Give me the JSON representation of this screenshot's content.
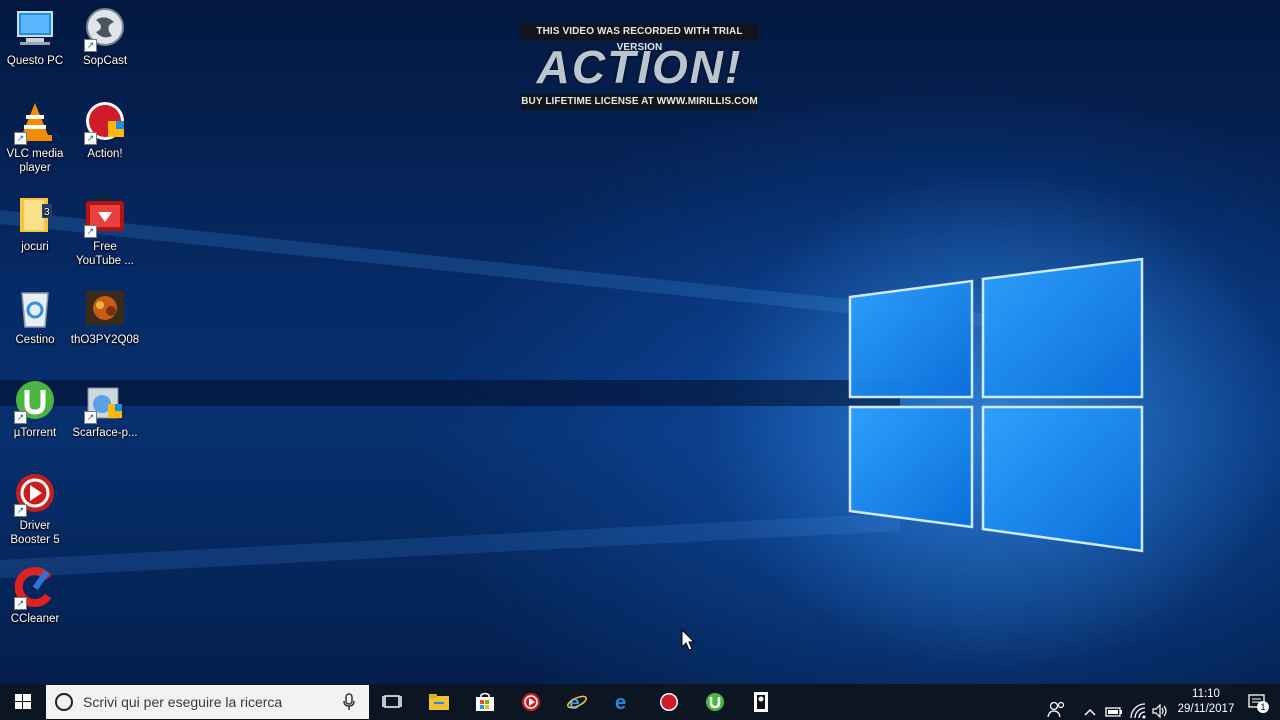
{
  "watermark": {
    "top": "THIS VIDEO WAS RECORDED WITH TRIAL VERSION",
    "logo": "ACTION!",
    "bottom": "BUY LIFETIME LICENSE AT WWW.MIRILLIS.COM"
  },
  "desktop": {
    "icons": [
      {
        "label": "Questo PC",
        "icon": "computer-icon"
      },
      {
        "label": "SopCast",
        "icon": "sopcast-icon"
      },
      {
        "label": "VLC media player",
        "icon": "vlc-cone-icon"
      },
      {
        "label": "Action!",
        "icon": "action-record-icon"
      },
      {
        "label": "jocuri",
        "icon": "folder-icon"
      },
      {
        "label": "Free YouTube ...",
        "icon": "tv-download-icon"
      },
      {
        "label": "Cestino",
        "icon": "recycle-bin-icon"
      },
      {
        "label": "thO3PY2Q08",
        "icon": "game-image-icon"
      },
      {
        "label": "µTorrent",
        "icon": "utorrent-icon"
      },
      {
        "label": "Scarface-p...",
        "icon": "setup-installer-icon"
      },
      {
        "label": "Driver Booster 5",
        "icon": "driver-booster-icon"
      },
      {
        "label": "CCleaner",
        "icon": "ccleaner-icon"
      }
    ]
  },
  "taskbar": {
    "search_placeholder": "Scrivi qui per eseguire la ricerca",
    "pinned": [
      "task-view-icon",
      "file-explorer-icon",
      "store-icon",
      "driver-booster-icon",
      "internet-explorer-icon",
      "edge-icon",
      "action-record-icon",
      "utorrent-icon",
      "game-app-icon"
    ],
    "clock": {
      "time": "11:10",
      "date": "29/11/2017"
    },
    "notifications_count": "1"
  },
  "colors": {
    "accent": "#0078d7",
    "taskbar": "#0c1522"
  }
}
